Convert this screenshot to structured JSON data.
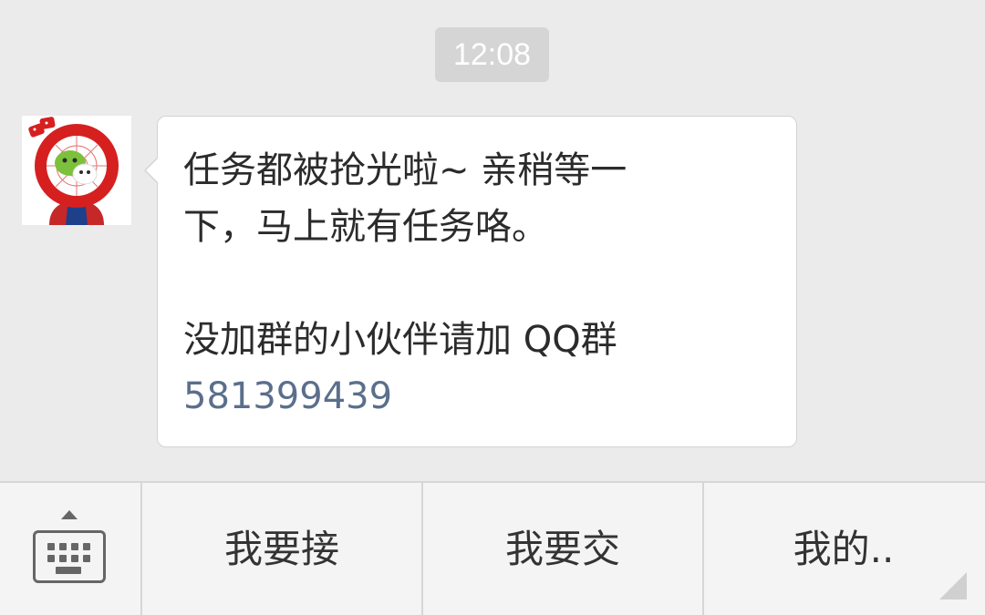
{
  "chat": {
    "timestamp": "12:08",
    "message": {
      "line1": "任务都被抢光啦~ 亲稍等一",
      "line2": "下，马上就有任务咯。",
      "line3": "没加群的小伙伴请加 QQ群",
      "link_number": "581399439"
    },
    "avatar_icon": "spiderman-wechat-avatar-icon"
  },
  "bottom_menu": {
    "keyboard_icon": "keyboard-icon",
    "items": [
      {
        "label": "我要接"
      },
      {
        "label": "我要交"
      },
      {
        "label": "我的.."
      }
    ]
  },
  "colors": {
    "chat_background": "#ebebeb",
    "bubble": "#ffffff",
    "link": "#5b6f8c",
    "timestamp_bg": "#d5d5d5"
  }
}
